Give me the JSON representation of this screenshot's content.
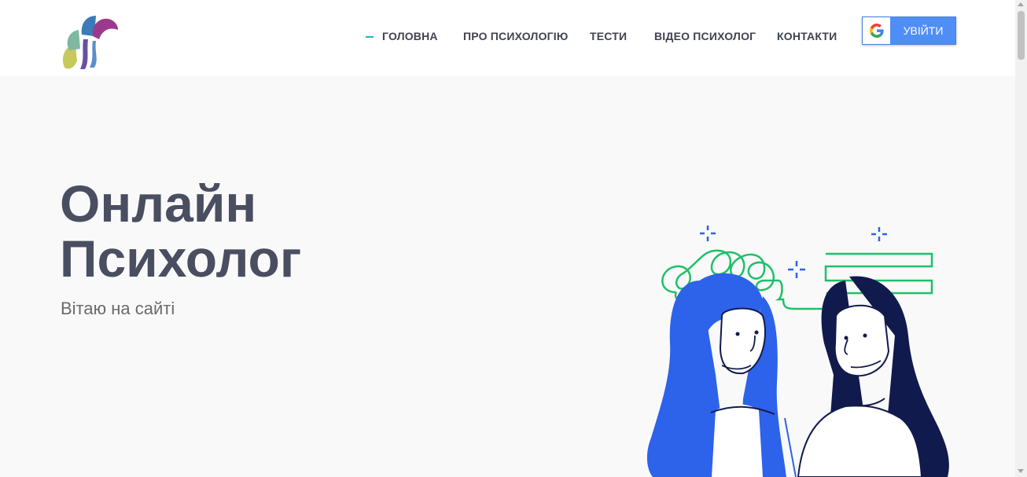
{
  "header": {
    "logo_icon": "brand-logo",
    "nav": [
      {
        "label": "ГОЛОВНА",
        "active": true
      },
      {
        "label": "ПРО ПСИХОЛОГІЮ",
        "active": false
      },
      {
        "label": "ТЕСТИ",
        "active": false
      },
      {
        "label": "ВІДЕО ПСИХОЛОГ",
        "active": false
      },
      {
        "label": "КОНТАКТИ",
        "active": false
      }
    ],
    "login": {
      "label": "УВІЙТИ",
      "icon": "google-icon"
    }
  },
  "hero": {
    "title_line1": "Онлайн",
    "title_line2": "Психолог",
    "subtitle": "Вітаю на сайті",
    "illustration": "two-women-illustration"
  },
  "colors": {
    "accent": "#1fb5c4",
    "button": "#4f8ef7",
    "title": "#4a4e61",
    "nav_text": "#3f4350",
    "hero_bg": "#f9f9f9",
    "illustration_blue": "#2d62ea",
    "illustration_navy": "#111a4d",
    "illustration_green": "#1ec069"
  }
}
